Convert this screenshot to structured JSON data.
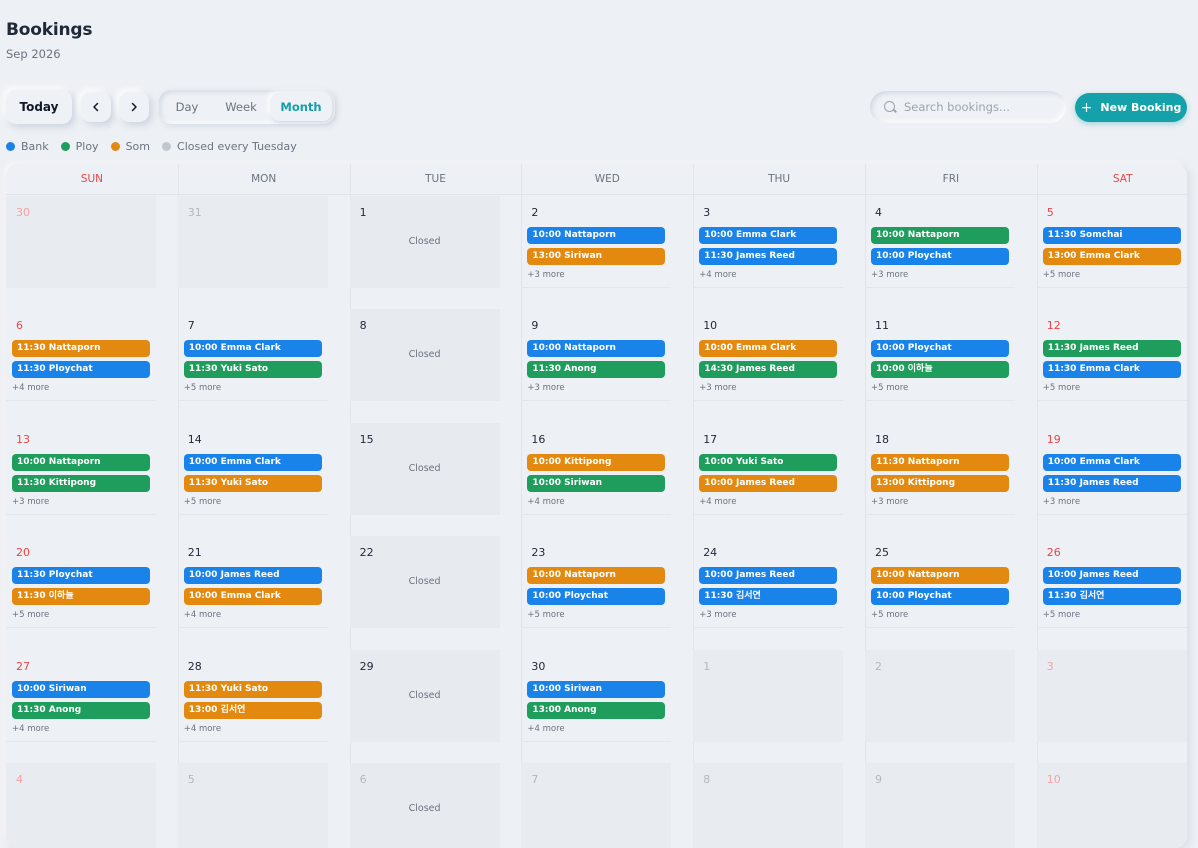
{
  "header": {
    "title": "Bookings",
    "month_label": "Sep 2026"
  },
  "toolbar": {
    "today_label": "Today",
    "prev_icon": "chevron-left-icon",
    "next_icon": "chevron-right-icon",
    "views": {
      "day": "Day",
      "week": "Week",
      "month": "Month"
    },
    "active_view": "month",
    "search_placeholder": "Search bookings...",
    "new_booking_label": "New Booking"
  },
  "legend": [
    {
      "label": "Bank",
      "color": "#1a83ea"
    },
    {
      "label": "Ploy",
      "color": "#1f9d5c"
    },
    {
      "label": "Som",
      "color": "#e3890f"
    },
    {
      "label": "Closed every Tuesday",
      "color": "#c2c7ce"
    }
  ],
  "calendar": {
    "weekdays": [
      "SUN",
      "MON",
      "TUE",
      "WED",
      "THU",
      "FRI",
      "SAT"
    ],
    "closed_label": "Closed",
    "weeks": [
      [
        {
          "day": "30",
          "dim": true
        },
        {
          "day": "31",
          "dim": true
        },
        {
          "day": "1",
          "closed": true
        },
        {
          "day": "2",
          "events": [
            {
              "text": "10:00 Nattaporn",
              "staff": 0
            },
            {
              "text": "13:00 Siriwan",
              "staff": 2
            }
          ],
          "more": "+3 more"
        },
        {
          "day": "3",
          "events": [
            {
              "text": "10:00 Emma Clark",
              "staff": 0
            },
            {
              "text": "11:30 James Reed",
              "staff": 0
            }
          ],
          "more": "+4 more"
        },
        {
          "day": "4",
          "events": [
            {
              "text": "10:00 Nattaporn",
              "staff": 1
            },
            {
              "text": "10:00 Ploychat",
              "staff": 0
            }
          ],
          "more": "+3 more"
        },
        {
          "day": "5",
          "events": [
            {
              "text": "11:30 Somchai",
              "staff": 0
            },
            {
              "text": "13:00 Emma Clark",
              "staff": 2
            }
          ],
          "more": "+5 more"
        }
      ],
      [
        {
          "day": "6",
          "events": [
            {
              "text": "11:30 Nattaporn",
              "staff": 2
            },
            {
              "text": "11:30 Ploychat",
              "staff": 0
            }
          ],
          "more": "+4 more"
        },
        {
          "day": "7",
          "events": [
            {
              "text": "10:00 Emma Clark",
              "staff": 0
            },
            {
              "text": "11:30 Yuki Sato",
              "staff": 1
            }
          ],
          "more": "+5 more"
        },
        {
          "day": "8",
          "closed": true
        },
        {
          "day": "9",
          "events": [
            {
              "text": "10:00 Nattaporn",
              "staff": 0
            },
            {
              "text": "11:30 Anong",
              "staff": 1
            }
          ],
          "more": "+3 more"
        },
        {
          "day": "10",
          "events": [
            {
              "text": "10:00 Emma Clark",
              "staff": 2
            },
            {
              "text": "14:30 James Reed",
              "staff": 1
            }
          ],
          "more": "+3 more"
        },
        {
          "day": "11",
          "events": [
            {
              "text": "10:00 Ploychat",
              "staff": 0
            },
            {
              "text": "10:00 이하늘",
              "staff": 1
            }
          ],
          "more": "+5 more"
        },
        {
          "day": "12",
          "events": [
            {
              "text": "11:30 James Reed",
              "staff": 1
            },
            {
              "text": "11:30 Emma Clark",
              "staff": 0
            }
          ],
          "more": "+5 more"
        }
      ],
      [
        {
          "day": "13",
          "events": [
            {
              "text": "10:00 Nattaporn",
              "staff": 1
            },
            {
              "text": "11:30 Kittipong",
              "staff": 1
            }
          ],
          "more": "+3 more"
        },
        {
          "day": "14",
          "events": [
            {
              "text": "10:00 Emma Clark",
              "staff": 0
            },
            {
              "text": "11:30 Yuki Sato",
              "staff": 2
            }
          ],
          "more": "+5 more"
        },
        {
          "day": "15",
          "closed": true
        },
        {
          "day": "16",
          "events": [
            {
              "text": "10:00 Kittipong",
              "staff": 2
            },
            {
              "text": "10:00 Siriwan",
              "staff": 1
            }
          ],
          "more": "+4 more"
        },
        {
          "day": "17",
          "events": [
            {
              "text": "10:00 Yuki Sato",
              "staff": 1
            },
            {
              "text": "10:00 James Reed",
              "staff": 2
            }
          ],
          "more": "+4 more"
        },
        {
          "day": "18",
          "events": [
            {
              "text": "11:30 Nattaporn",
              "staff": 2
            },
            {
              "text": "13:00 Kittipong",
              "staff": 2
            }
          ],
          "more": "+3 more"
        },
        {
          "day": "19",
          "events": [
            {
              "text": "10:00 Emma Clark",
              "staff": 0
            },
            {
              "text": "11:30 James Reed",
              "staff": 0
            }
          ],
          "more": "+3 more"
        }
      ],
      [
        {
          "day": "20",
          "events": [
            {
              "text": "11:30 Ploychat",
              "staff": 0
            },
            {
              "text": "11:30 이하늘",
              "staff": 2
            }
          ],
          "more": "+5 more"
        },
        {
          "day": "21",
          "events": [
            {
              "text": "10:00 James Reed",
              "staff": 0
            },
            {
              "text": "10:00 Emma Clark",
              "staff": 2
            }
          ],
          "more": "+4 more"
        },
        {
          "day": "22",
          "closed": true
        },
        {
          "day": "23",
          "events": [
            {
              "text": "10:00 Nattaporn",
              "staff": 2
            },
            {
              "text": "10:00 Ploychat",
              "staff": 0
            }
          ],
          "more": "+5 more"
        },
        {
          "day": "24",
          "events": [
            {
              "text": "10:00 James Reed",
              "staff": 0
            },
            {
              "text": "11:30 김서연",
              "staff": 0
            }
          ],
          "more": "+3 more"
        },
        {
          "day": "25",
          "events": [
            {
              "text": "10:00 Nattaporn",
              "staff": 2
            },
            {
              "text": "10:00 Ploychat",
              "staff": 0
            }
          ],
          "more": "+5 more"
        },
        {
          "day": "26",
          "events": [
            {
              "text": "10:00 James Reed",
              "staff": 0
            },
            {
              "text": "11:30 김서연",
              "staff": 0
            }
          ],
          "more": "+5 more"
        }
      ],
      [
        {
          "day": "27",
          "events": [
            {
              "text": "10:00 Siriwan",
              "staff": 0
            },
            {
              "text": "11:30 Anong",
              "staff": 1
            }
          ],
          "more": "+4 more"
        },
        {
          "day": "28",
          "events": [
            {
              "text": "11:30 Yuki Sato",
              "staff": 2
            },
            {
              "text": "13:00 김서연",
              "staff": 2
            }
          ],
          "more": "+4 more"
        },
        {
          "day": "29",
          "closed": true
        },
        {
          "day": "30",
          "events": [
            {
              "text": "10:00 Siriwan",
              "staff": 0
            },
            {
              "text": "13:00 Anong",
              "staff": 1
            }
          ],
          "more": "+4 more"
        },
        {
          "day": "1",
          "dim": true
        },
        {
          "day": "2",
          "dim": true
        },
        {
          "day": "3",
          "dim": true
        }
      ],
      [
        {
          "day": "4",
          "dim": true
        },
        {
          "day": "5",
          "dim": true
        },
        {
          "day": "6",
          "dim": true,
          "closed": true
        },
        {
          "day": "7",
          "dim": true
        },
        {
          "day": "8",
          "dim": true
        },
        {
          "day": "9",
          "dim": true
        },
        {
          "day": "10",
          "dim": true
        }
      ]
    ]
  }
}
